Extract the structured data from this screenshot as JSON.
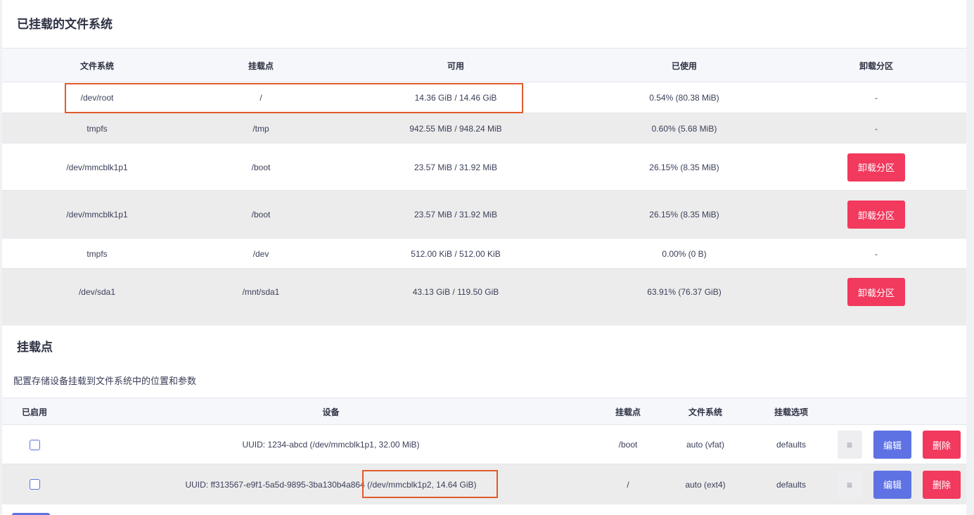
{
  "mounted": {
    "title": "已挂载的文件系统",
    "headers": [
      "文件系统",
      "挂载点",
      "可用",
      "已使用",
      "卸载分区"
    ],
    "rows": [
      {
        "fs": "/dev/root",
        "mount": "/",
        "available": "14.36 GiB / 14.46 GiB",
        "used": "0.54% (80.38 MiB)",
        "unmount": "-"
      },
      {
        "fs": "tmpfs",
        "mount": "/tmp",
        "available": "942.55 MiB / 948.24 MiB",
        "used": "0.60% (5.68 MiB)",
        "unmount": "-"
      },
      {
        "fs": "/dev/mmcblk1p1",
        "mount": "/boot",
        "available": "23.57 MiB / 31.92 MiB",
        "used": "26.15% (8.35 MiB)",
        "unmount": "卸载分区"
      },
      {
        "fs": "/dev/mmcblk1p1",
        "mount": "/boot",
        "available": "23.57 MiB / 31.92 MiB",
        "used": "26.15% (8.35 MiB)",
        "unmount": "卸载分区"
      },
      {
        "fs": "tmpfs",
        "mount": "/dev",
        "available": "512.00 KiB / 512.00 KiB",
        "used": "0.00% (0 B)",
        "unmount": "-"
      },
      {
        "fs": "/dev/sda1",
        "mount": "/mnt/sda1",
        "available": "43.13 GiB / 119.50 GiB",
        "used": "63.91% (76.37 GiB)",
        "unmount": "卸载分区"
      }
    ]
  },
  "mountpoints": {
    "title": "挂载点",
    "description": "配置存储设备挂载到文件系统中的位置和参数",
    "headers": [
      "已启用",
      "设备",
      "挂载点",
      "文件系统",
      "挂载选项"
    ],
    "rows": [
      {
        "enabled": false,
        "device": "UUID: 1234-abcd (/dev/mmcblk1p1, 32.00 MiB)",
        "mount": "/boot",
        "fs": "auto (vfat)",
        "options": "defaults",
        "drag": "≡",
        "edit": "编辑",
        "delete": "删除"
      },
      {
        "enabled": false,
        "device": "UUID: ff313567-e9f1-5a5d-9895-3ba130b4a864 (/dev/mmcblk1p2, 14.64 GiB)",
        "mount": "/",
        "fs": "auto (ext4)",
        "options": "defaults",
        "drag": "≡",
        "edit": "编辑",
        "delete": "删除"
      }
    ]
  },
  "colors": {
    "danger": "#f2395e",
    "primary": "#5e72e4",
    "annotation": "#e25a2c"
  }
}
